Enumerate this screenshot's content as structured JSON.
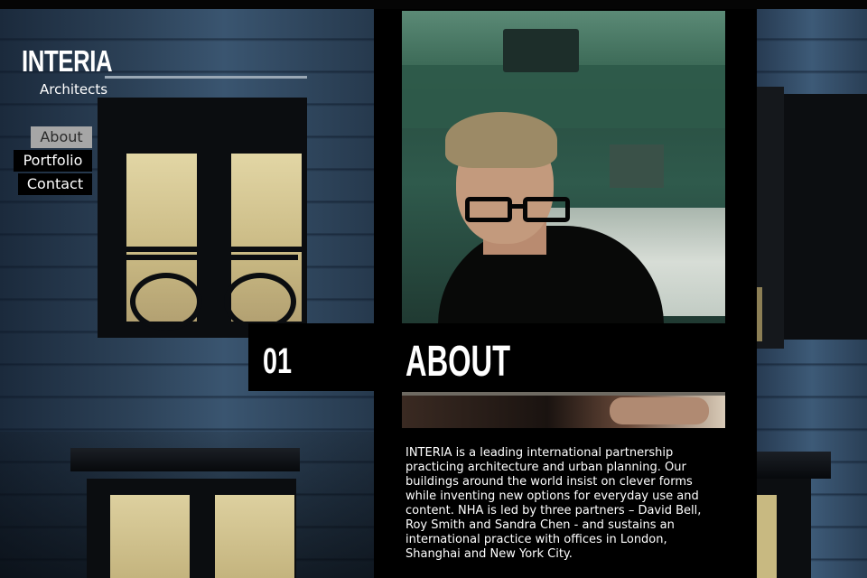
{
  "brand": {
    "name": "INTERIA",
    "tagline": "Architects"
  },
  "nav": {
    "items": [
      {
        "label": "About",
        "active": true
      },
      {
        "label": "Portfolio",
        "active": false
      },
      {
        "label": "Contact",
        "active": false
      }
    ]
  },
  "section": {
    "number": "01",
    "title": "ABOUT",
    "body": "INTERIA is a leading international partnership practicing architecture and urban planning. Our buildings around the world insist on clever forms while inventing new options for everyday use and content. NHA is led by three partners – David Bell, Roy Smith and Sandra Chen - and sustains an international practice with offices in London, Shanghai and New York City."
  },
  "colors": {
    "background": "#000000",
    "nav_active_bg": "#a6a6a6",
    "text": "#ffffff"
  }
}
